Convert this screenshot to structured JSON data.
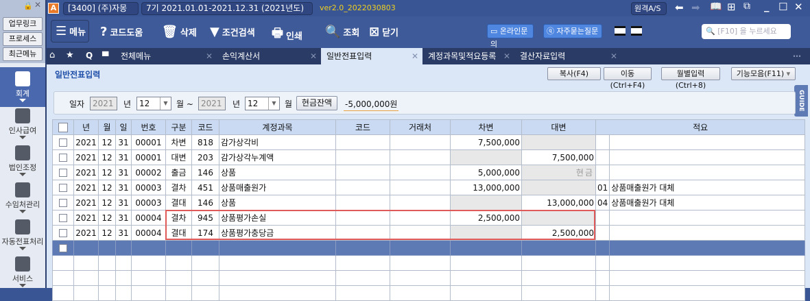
{
  "left": {
    "quick": [
      "업무링크",
      "프로세스",
      "최근메뉴"
    ],
    "modules": [
      {
        "label": "회계",
        "icon": "calculator-icon",
        "active": true
      },
      {
        "label": "인사급여",
        "icon": "person-coins-icon"
      },
      {
        "label": "법인조정",
        "icon": "building-icon"
      },
      {
        "label": "수임처관리",
        "icon": "person-building-icon"
      },
      {
        "label": "자동전표처리",
        "icon": "docs-db-icon"
      },
      {
        "label": "서비스",
        "icon": "monitor-icon"
      }
    ]
  },
  "top": {
    "company": "[3400] (주)자몽",
    "period": "7기 2021.01.01-2021.12.31 (2021년도)",
    "version": "ver2.0_2022030803",
    "remote": "원격A/S"
  },
  "toolbar": {
    "menu": "메뉴",
    "codehelp": "코드도움",
    "delete": "삭제",
    "filter": "조건검색",
    "print": "인쇄",
    "search": "조회",
    "close": "닫기",
    "online": "온라인문의",
    "faq": "자주묻는질문",
    "search_placeholder": "[F10] 을 누르세요"
  },
  "tabs": [
    {
      "label": "전체메뉴"
    },
    {
      "label": "손익계산서"
    },
    {
      "label": "일반전표입력",
      "active": true
    },
    {
      "label": "계정과목및적요등록"
    },
    {
      "label": "결산자료입력"
    }
  ],
  "page": {
    "title": "일반전표입력",
    "buttons": [
      "복사(F4)",
      "이동(Ctrl+F4)",
      "월별입력(Ctrl+8)",
      "기능모음(F11)"
    ],
    "guide": "GUIDE"
  },
  "filter": {
    "date_label": "일자",
    "year_from": "2021",
    "year_unit": "년",
    "month_from": "12",
    "month_unit": "월 ~",
    "year_to": "2021",
    "month_to": "12",
    "month_unit2": "월",
    "cash_button": "현금잔액",
    "cash_value": "-5,000,000원"
  },
  "table": {
    "headers": [
      "년",
      "월",
      "일",
      "번호",
      "구분",
      "코드",
      "계정과목",
      "코드",
      "거래처",
      "차변",
      "대변",
      "적요"
    ],
    "rows": [
      [
        "2021",
        "12",
        "31",
        "00001",
        "차변",
        "818",
        "감가상각비",
        "",
        "",
        "7,500,000",
        "",
        "",
        ""
      ],
      [
        "2021",
        "12",
        "31",
        "00001",
        "대변",
        "203",
        "감가상각누계액",
        "",
        "",
        "",
        "7,500,000",
        "",
        ""
      ],
      [
        "2021",
        "12",
        "31",
        "00002",
        "출금",
        "146",
        "상품",
        "",
        "",
        "5,000,000",
        "현금",
        "",
        ""
      ],
      [
        "2021",
        "12",
        "31",
        "00003",
        "결차",
        "451",
        "상품매출원가",
        "",
        "",
        "13,000,000",
        "",
        "01",
        "상품매출원가 대체"
      ],
      [
        "2021",
        "12",
        "31",
        "00003",
        "결대",
        "146",
        "상품",
        "",
        "",
        "",
        "13,000,000",
        "04",
        "상품매출원가 대체"
      ],
      [
        "2021",
        "12",
        "31",
        "00004",
        "결차",
        "945",
        "상품평가손실",
        "",
        "",
        "2,500,000",
        "",
        "",
        ""
      ],
      [
        "2021",
        "12",
        "31",
        "00004",
        "결대",
        "174",
        "상품평가충당금",
        "",
        "",
        "",
        "2,500,000",
        "",
        ""
      ]
    ]
  }
}
